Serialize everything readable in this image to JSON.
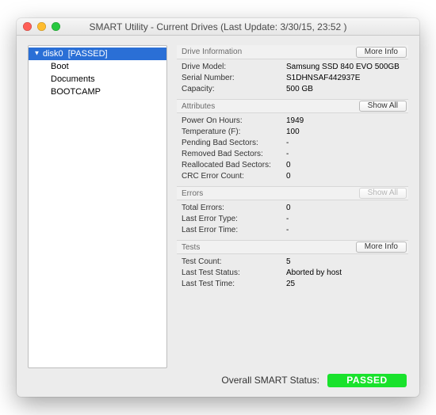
{
  "window": {
    "title": "SMART Utility - Current Drives (Last Update: 3/30/15, 23:52 )"
  },
  "sidebar": {
    "root": {
      "name": "disk0",
      "status": "[PASSED]"
    },
    "partitions": [
      "Boot",
      "Documents",
      "BOOTCAMP"
    ]
  },
  "sections": {
    "drive_info": {
      "title": "Drive Information",
      "button": "More Info",
      "rows": {
        "model_k": "Drive Model:",
        "model_v": "Samsung SSD 840 EVO 500GB",
        "serial_k": "Serial Number:",
        "serial_v": "S1DHNSAF442937E",
        "capacity_k": "Capacity:",
        "capacity_v": "500 GB"
      }
    },
    "attributes": {
      "title": "Attributes",
      "button": "Show All",
      "rows": {
        "poh_k": "Power On Hours:",
        "poh_v": "1949",
        "temp_k": "Temperature (F):",
        "temp_v": "100",
        "pbs_k": "Pending Bad Sectors:",
        "pbs_v": "-",
        "rbs_k": "Removed Bad Sectors:",
        "rbs_v": "-",
        "ras_k": "Reallocated Bad Sectors:",
        "ras_v": "0",
        "crc_k": "CRC Error Count:",
        "crc_v": "0"
      }
    },
    "errors": {
      "title": "Errors",
      "button": "Show All",
      "rows": {
        "te_k": "Total Errors:",
        "te_v": "0",
        "let_k": "Last Error Type:",
        "let_v": "-",
        "letm_k": "Last Error Time:",
        "letm_v": "-"
      }
    },
    "tests": {
      "title": "Tests",
      "button": "More Info",
      "rows": {
        "tc_k": "Test Count:",
        "tc_v": "5",
        "lts_k": "Last Test Status:",
        "lts_v": "Aborted by host",
        "ltt_k": "Last Test Time:",
        "ltt_v": "25"
      }
    }
  },
  "footer": {
    "label": "Overall SMART Status:",
    "status": "PASSED"
  },
  "colors": {
    "status_pass": "#19e22c",
    "selection": "#2a6fd6"
  }
}
